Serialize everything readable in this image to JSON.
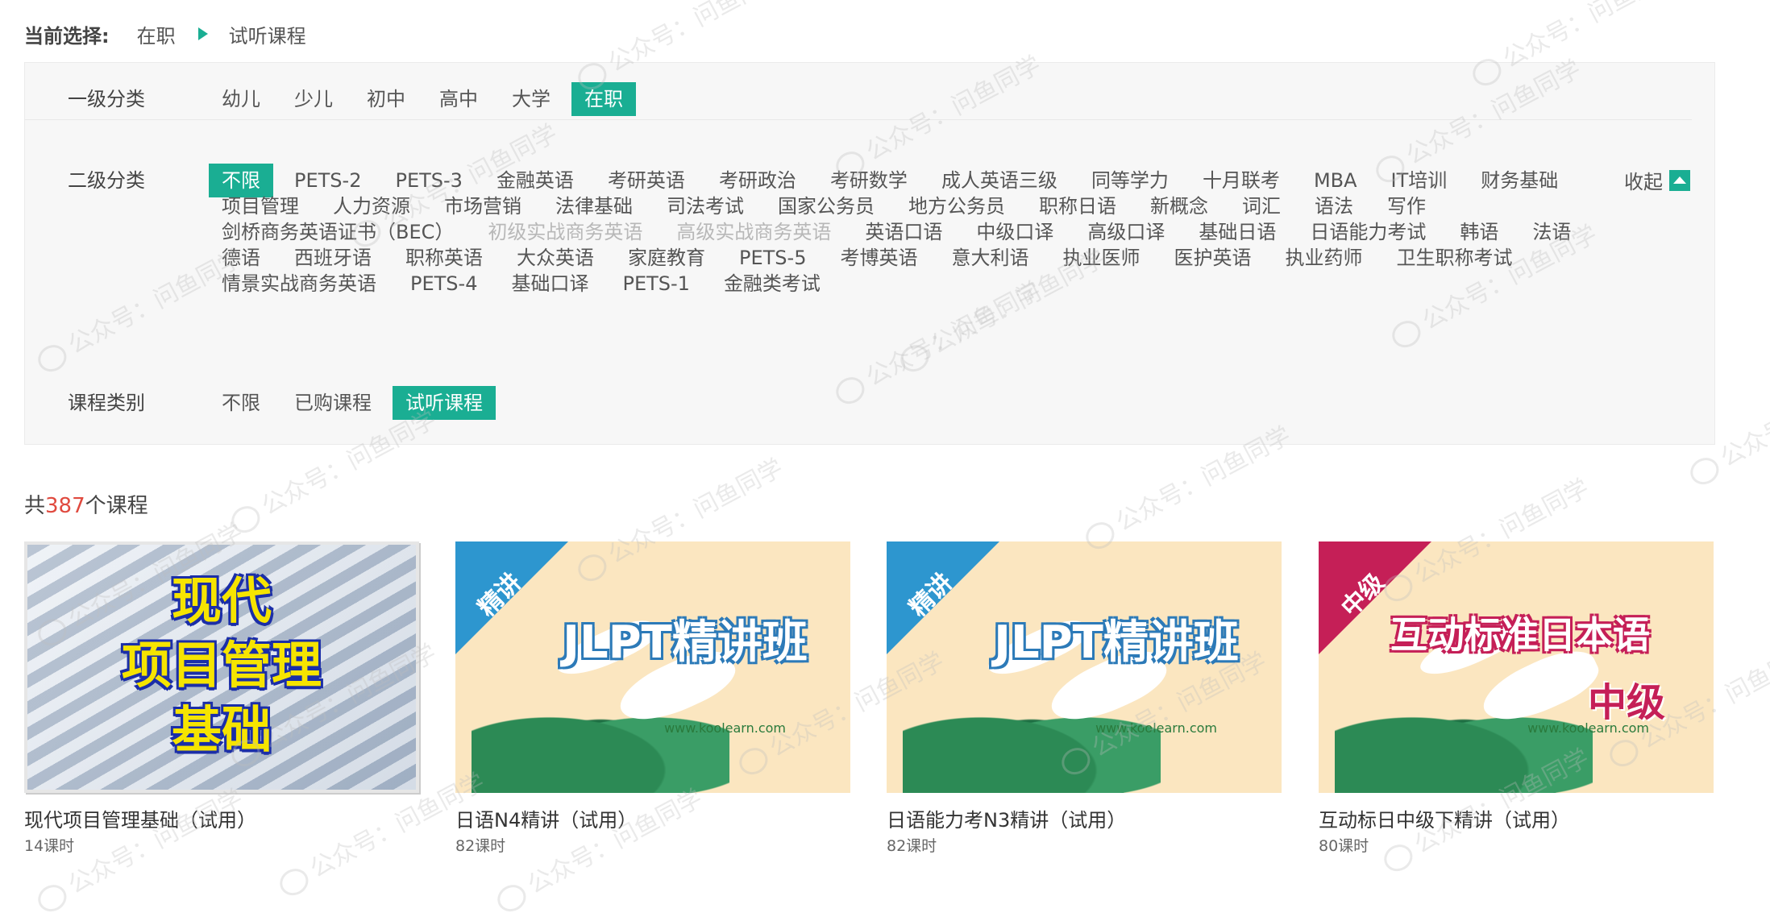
{
  "breadcrumb": {
    "label": "当前选择:",
    "items": [
      "在职",
      "试听课程"
    ]
  },
  "filters": {
    "level1": {
      "label": "一级分类",
      "options": [
        "幼儿",
        "少儿",
        "初中",
        "高中",
        "大学",
        "在职"
      ],
      "selected": "在职"
    },
    "level2": {
      "label": "二级分类",
      "collapse_label": "收起",
      "lines": [
        [
          "不限",
          "PETS-2",
          "PETS-3",
          "金融英语",
          "考研英语",
          "考研政治",
          "考研数学",
          "成人英语三级",
          "同等学力",
          "十月联考",
          "MBA",
          "IT培训",
          "财务基础"
        ],
        [
          "项目管理",
          "人力资源",
          "市场营销",
          "法律基础",
          "司法考试",
          "国家公务员",
          "地方公务员",
          "职称日语",
          "新概念",
          "词汇",
          "语法",
          "写作"
        ],
        [
          "剑桥商务英语证书（BEC）",
          "初级实战商务英语",
          "高级实战商务英语",
          "英语口语",
          "中级口译",
          "高级口译",
          "基础日语",
          "日语能力考试",
          "韩语",
          "法语"
        ],
        [
          "德语",
          "西班牙语",
          "职称英语",
          "大众英语",
          "家庭教育",
          "PETS-5",
          "考博英语",
          "意大利语",
          "执业医师",
          "医护英语",
          "执业药师",
          "卫生职称考试"
        ],
        [
          "情景实战商务英语",
          "PETS-4",
          "基础口译",
          "PETS-1",
          "金融类考试"
        ]
      ],
      "selected": "不限",
      "disabled": [
        "初级实战商务英语",
        "高级实战商务英语"
      ]
    },
    "course_type": {
      "label": "课程类别",
      "options": [
        "不限",
        "已购课程",
        "试听课程"
      ],
      "selected": "试听课程"
    }
  },
  "summary": {
    "prefix": "共",
    "count": "387",
    "suffix": "个课程"
  },
  "courses": [
    {
      "title": "现代项目管理基础（试用）",
      "lessons": "14课时",
      "thumb_lines": [
        "现代",
        "项目管理",
        "基础"
      ]
    },
    {
      "title": "日语N4精讲（试用）",
      "lessons": "82课时",
      "corner": "精讲",
      "banner": "JLPT精讲班",
      "site": "www.koolearn.com"
    },
    {
      "title": "日语能力考N3精讲（试用）",
      "lessons": "82课时",
      "corner": "精讲",
      "banner": "JLPT精讲班",
      "site": "www.koolearn.com"
    },
    {
      "title": "互动标日中级下精讲（试用）",
      "lessons": "80课时",
      "corner": "中级",
      "banner": "互动标准日本语",
      "level": "中级",
      "site": "www.koolearn.com"
    }
  ],
  "watermark": "公众号：问鱼同学",
  "colors": {
    "accent": "#1aae93",
    "count": "#e04a3f",
    "corner_blue": "#2d96cf",
    "corner_red": "#c51f57"
  }
}
